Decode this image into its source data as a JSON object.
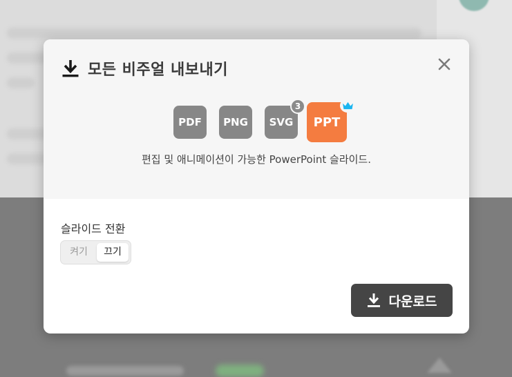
{
  "modal": {
    "title": "모든 비주얼 내보내기",
    "icons": {
      "title": "download-icon",
      "close": "close-icon",
      "crown": "crown-icon",
      "download": "download-icon"
    },
    "formats": [
      {
        "label": "PDF",
        "color": "#878787"
      },
      {
        "label": "PNG",
        "color": "#878787"
      },
      {
        "label": "SVG",
        "color": "#878787",
        "badge": "3"
      },
      {
        "label": "PPT",
        "color": "#F47C40",
        "selected": true
      }
    ],
    "description": "편집 및 애니메이션이 가능한 PowerPoint 슬라이드.",
    "transition": {
      "label": "슬라이드 전환",
      "options": [
        "켜기",
        "끄기"
      ],
      "selected": "끄기"
    },
    "download_label": "다운로드"
  },
  "colors": {
    "accent": "#F47C40",
    "premium": "#1BB5F0",
    "button_dark": "#454545"
  }
}
